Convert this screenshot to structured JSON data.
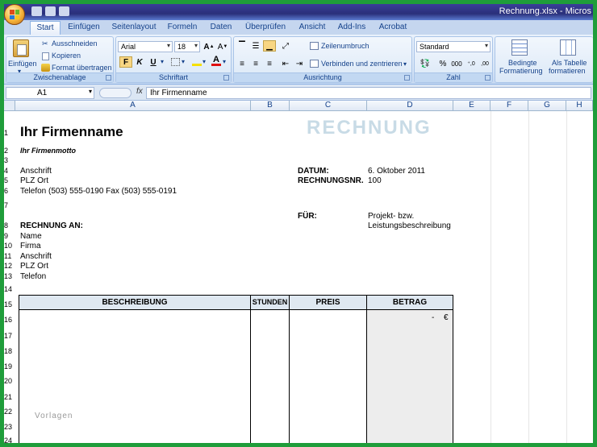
{
  "window": {
    "title": "Rechnung.xlsx - Micros"
  },
  "tabs": [
    "Start",
    "Einfügen",
    "Seitenlayout",
    "Formeln",
    "Daten",
    "Überprüfen",
    "Ansicht",
    "Add-Ins",
    "Acrobat"
  ],
  "ribbon": {
    "clipboard": {
      "group_label": "Zwischenablage",
      "paste_label": "Einfügen",
      "cut_label": "Ausschneiden",
      "copy_label": "Kopieren",
      "format_painter_label": "Format übertragen"
    },
    "font": {
      "group_label": "Schriftart",
      "font_name": "Arial",
      "font_size": "18",
      "bold_label": "F",
      "italic_label": "K",
      "underline_label": "U"
    },
    "alignment": {
      "group_label": "Ausrichtung",
      "wrap_label": "Zeilenumbruch",
      "merge_label": "Verbinden und zentrieren"
    },
    "number": {
      "group_label": "Zahl",
      "format_value": "Standard"
    },
    "styles": {
      "conditional_label_1": "Bedingte",
      "conditional_label_2": "Formatierung",
      "table_label_1": "Als Tabelle",
      "table_label_2": "formatieren"
    }
  },
  "formula_bar": {
    "name_box": "A1",
    "fx": "fx",
    "content": "Ihr Firmenname"
  },
  "columns": [
    "A",
    "B",
    "C",
    "D",
    "E",
    "F",
    "G",
    "H"
  ],
  "rows": [
    "1",
    "2",
    "3",
    "4",
    "5",
    "6",
    "7",
    "8",
    "9",
    "10",
    "11",
    "12",
    "13",
    "14",
    "15",
    "16",
    "17",
    "18",
    "19",
    "20",
    "21",
    "22",
    "23",
    "24"
  ],
  "sheet": {
    "company_name": "Ihr Firmenname",
    "invoice_title": "RECHNUNG",
    "motto": "Ihr Firmenmotto",
    "address": "Anschrift",
    "zip_city": "PLZ Ort",
    "phone_fax": "Telefon (503) 555-0190  Fax (503) 555-0191",
    "date_label": "DATUM:",
    "date_value": "6. Oktober 2011",
    "invoice_no_label": "RECHNUNGSNR.",
    "invoice_no_value": "100",
    "for_label": "FÜR:",
    "for_value_1": "Projekt- bzw.",
    "for_value_2": "Leistungsbeschreibung",
    "bill_to_label": "RECHNUNG AN:",
    "bill_name": "Name",
    "bill_company": "Firma",
    "bill_address": "Anschrift",
    "bill_zip_city": "PLZ Ort",
    "bill_phone": "Telefon",
    "table": {
      "headers": [
        "BESCHREIBUNG",
        "STUNDEN",
        "PREIS",
        "BETRAG"
      ],
      "amount_value": "-",
      "currency": "€"
    },
    "watermark": "Vorlagen"
  }
}
